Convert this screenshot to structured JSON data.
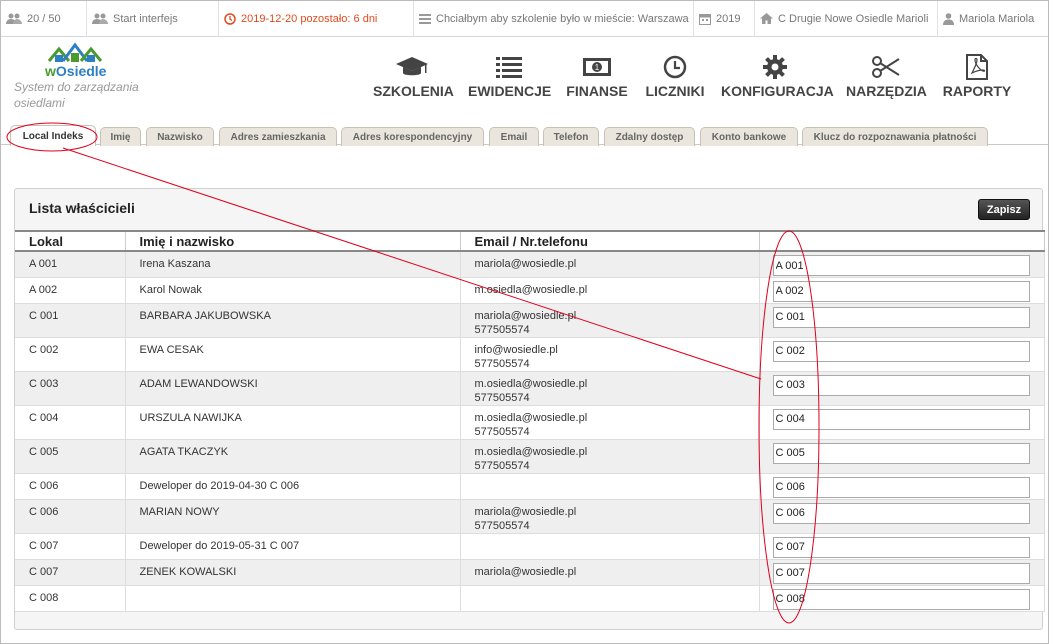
{
  "topbar": {
    "users_count": "20 / 50",
    "start_label": "Start interfejs",
    "deadline": "2019-12-20 pozostało: 6 dni",
    "message": "Chciałbym aby szkolenie było w mieście: Warszawa",
    "year": "2019",
    "estate": "C Drugie Nowe Osiedle Marioli",
    "user": "Mariola Mariola"
  },
  "logo": {
    "name_w": "w",
    "name_rest": "Osiedle",
    "tagline": "System do zarządzania osiedlami"
  },
  "nav": [
    {
      "label": "SZKOLENIA",
      "icon": "graduation-cap-icon"
    },
    {
      "label": "EWIDENCJE",
      "icon": "list-icon"
    },
    {
      "label": "FINANSE",
      "icon": "money-icon"
    },
    {
      "label": "LICZNIKI",
      "icon": "clock-icon"
    },
    {
      "label": "KONFIGURACJA",
      "icon": "gear-icon"
    },
    {
      "label": "NARZĘDZIA",
      "icon": "scissors-icon"
    },
    {
      "label": "RAPORTY",
      "icon": "pdf-icon"
    }
  ],
  "tabs": [
    "Local Indeks",
    "Imię",
    "Nazwisko",
    "Adres zamieszkania",
    "Adres korespondencyjny",
    "Email",
    "Telefon",
    "Zdalny dostęp",
    "Konto bankowe",
    "Klucz do rozpoznawania płatności"
  ],
  "active_tab": "Local Indeks",
  "panel": {
    "title": "Lista właścicieli",
    "save_label": "Zapisz",
    "columns": [
      "Lokal",
      "Imię i nazwisko",
      "Email / Nr.telefonu",
      ""
    ],
    "rows": [
      {
        "lokal": "A 001",
        "name": "Irena Kaszana",
        "email": "mariola@wosiedle.pl",
        "phone": "",
        "value": "A 001"
      },
      {
        "lokal": "A 002",
        "name": "Karol Nowak",
        "email": "m.osiedla@wosiedle.pl",
        "phone": "",
        "value": "A 002"
      },
      {
        "lokal": "C 001",
        "name": "BARBARA JAKUBOWSKA",
        "email": "mariola@wosiedle.pl",
        "phone": "577505574",
        "value": "C 001"
      },
      {
        "lokal": "C 002",
        "name": "EWA CESAK",
        "email": "info@wosiedle.pl",
        "phone": "577505574",
        "value": "C 002"
      },
      {
        "lokal": "C 003",
        "name": "ADAM LEWANDOWSKI",
        "email": "m.osiedla@wosiedle.pl",
        "phone": "577505574",
        "value": "C 003"
      },
      {
        "lokal": "C 004",
        "name": "URSZULA NAWIJKA",
        "email": "m.osiedla@wosiedle.pl",
        "phone": "577505574",
        "value": "C 004"
      },
      {
        "lokal": "C 005",
        "name": "AGATA TKACZYK",
        "email": "m.osiedla@wosiedle.pl",
        "phone": "577505574",
        "value": "C 005"
      },
      {
        "lokal": "C 006",
        "name": "Deweloper do 2019-04-30 C 006",
        "email": "",
        "phone": "",
        "value": "C 006"
      },
      {
        "lokal": "C 006",
        "name": "MARIAN NOWY",
        "email": "mariola@wosiedle.pl",
        "phone": "577505574",
        "value": "C 006"
      },
      {
        "lokal": "C 007",
        "name": "Deweloper do 2019-05-31 C 007",
        "email": "",
        "phone": "",
        "value": "C 007"
      },
      {
        "lokal": "C 007",
        "name": "ZENEK KOWALSKI",
        "email": "mariola@wosiedle.pl",
        "phone": "",
        "value": "C 007"
      },
      {
        "lokal": "C 008",
        "name": "",
        "email": "",
        "phone": "",
        "value": "C 008"
      }
    ]
  },
  "colors": {
    "annotation": "#e0001b",
    "warning": "#e04b1f",
    "logo_blue": "#2c7fc3",
    "logo_green": "#4a9a2d"
  }
}
